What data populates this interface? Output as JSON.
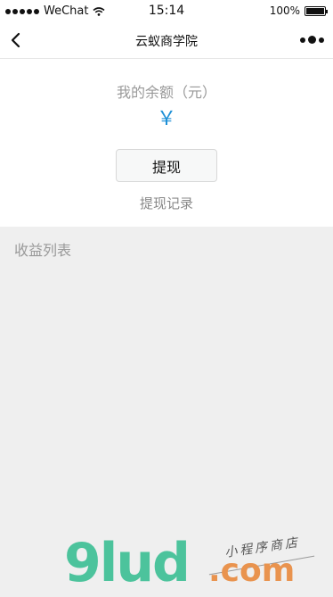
{
  "status_bar": {
    "carrier": "WeChat",
    "time": "15:14",
    "battery": "100%",
    "battery_level": 1.0
  },
  "nav": {
    "title": "云蚁商学院",
    "back_icon": "chevron-left-icon",
    "more_icon": "more-dots-icon"
  },
  "balance": {
    "label": "我的余额（元）",
    "currency_symbol": "￥",
    "withdraw_button": "提现",
    "records_link": "提现记录",
    "accent_color": "#1d8fd6"
  },
  "earnings": {
    "title": "收益列表",
    "items": []
  },
  "watermark": {
    "brand": "9lud",
    "domain": ".com",
    "tagline": "小程序商店"
  }
}
